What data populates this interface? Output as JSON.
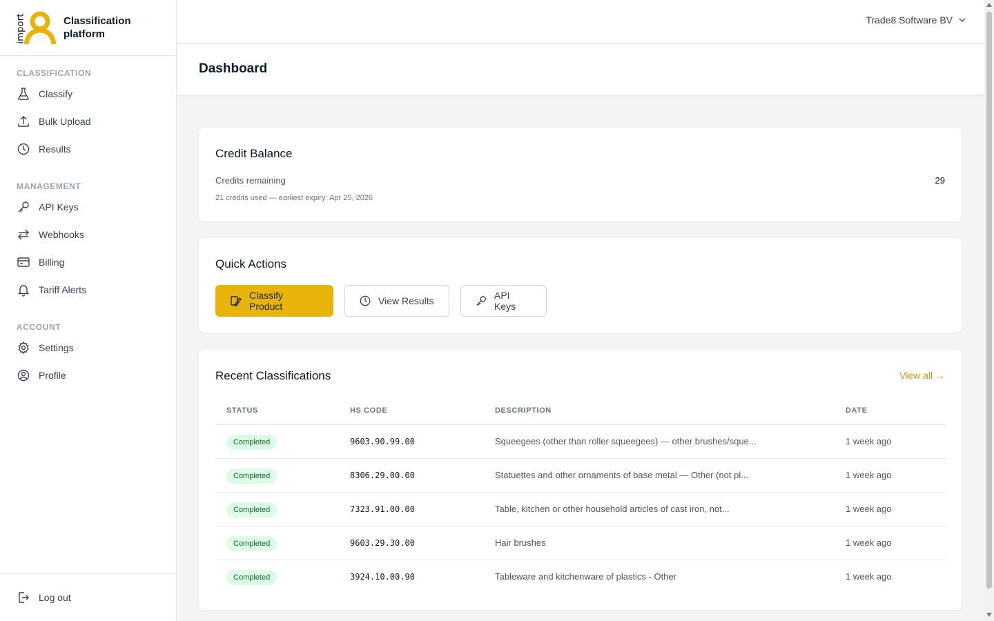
{
  "brand": {
    "logo_text": "import",
    "name_line1": "Classification",
    "name_line2": "platform"
  },
  "sidebar": {
    "sections": [
      {
        "heading": "CLASSIFICATION",
        "items": [
          {
            "label": "Classify",
            "icon": "flask-icon"
          },
          {
            "label": "Bulk Upload",
            "icon": "upload-icon"
          },
          {
            "label": "Results",
            "icon": "clock-icon"
          }
        ]
      },
      {
        "heading": "MANAGEMENT",
        "items": [
          {
            "label": "API Keys",
            "icon": "key-icon"
          },
          {
            "label": "Webhooks",
            "icon": "arrows-icon"
          },
          {
            "label": "Billing",
            "icon": "card-icon"
          },
          {
            "label": "Tariff Alerts",
            "icon": "bell-icon"
          }
        ]
      },
      {
        "heading": "ACCOUNT",
        "items": [
          {
            "label": "Settings",
            "icon": "gear-icon"
          },
          {
            "label": "Profile",
            "icon": "user-circle-icon"
          }
        ]
      }
    ],
    "logout_label": "Log out"
  },
  "topbar": {
    "company": "Trade8 Software BV"
  },
  "page": {
    "title": "Dashboard"
  },
  "credit": {
    "title": "Credit Balance",
    "label": "Credits remaining",
    "value": "29",
    "sub": "21 credits used — earliest expiry: Apr 25, 2026"
  },
  "actions": {
    "title": "Quick Actions",
    "classify_label": "Classify Product",
    "results_label": "View Results",
    "keys_label": "API Keys"
  },
  "recent": {
    "title": "Recent Classifications",
    "view_all": "View all →",
    "headers": [
      "STATUS",
      "HS CODE",
      "DESCRIPTION",
      "DATE"
    ],
    "rows": [
      {
        "status": "Completed",
        "code": "9603.90.99.00",
        "description": "Squeegees (other than roller squeegees) — other brushes/sque...",
        "date": "1 week ago"
      },
      {
        "status": "Completed",
        "code": "8306.29.00.00",
        "description": "Statuettes and other ornaments of base metal — Other (not pl...",
        "date": "1 week ago"
      },
      {
        "status": "Completed",
        "code": "7323.91.00.00",
        "description": "Table, kitchen or other household articles of cast iron, not...",
        "date": "1 week ago"
      },
      {
        "status": "Completed",
        "code": "9603.29.30.00",
        "description": "Hair brushes",
        "date": "1 week ago"
      },
      {
        "status": "Completed",
        "code": "3924.10.00.90",
        "description": "Tableware and kitchenware of plastics - Other",
        "date": "1 week ago"
      }
    ]
  },
  "colors": {
    "accent": "#e8b40a",
    "badge_bg": "#dcfce7",
    "badge_text": "#166534",
    "link": "#c9960a"
  }
}
